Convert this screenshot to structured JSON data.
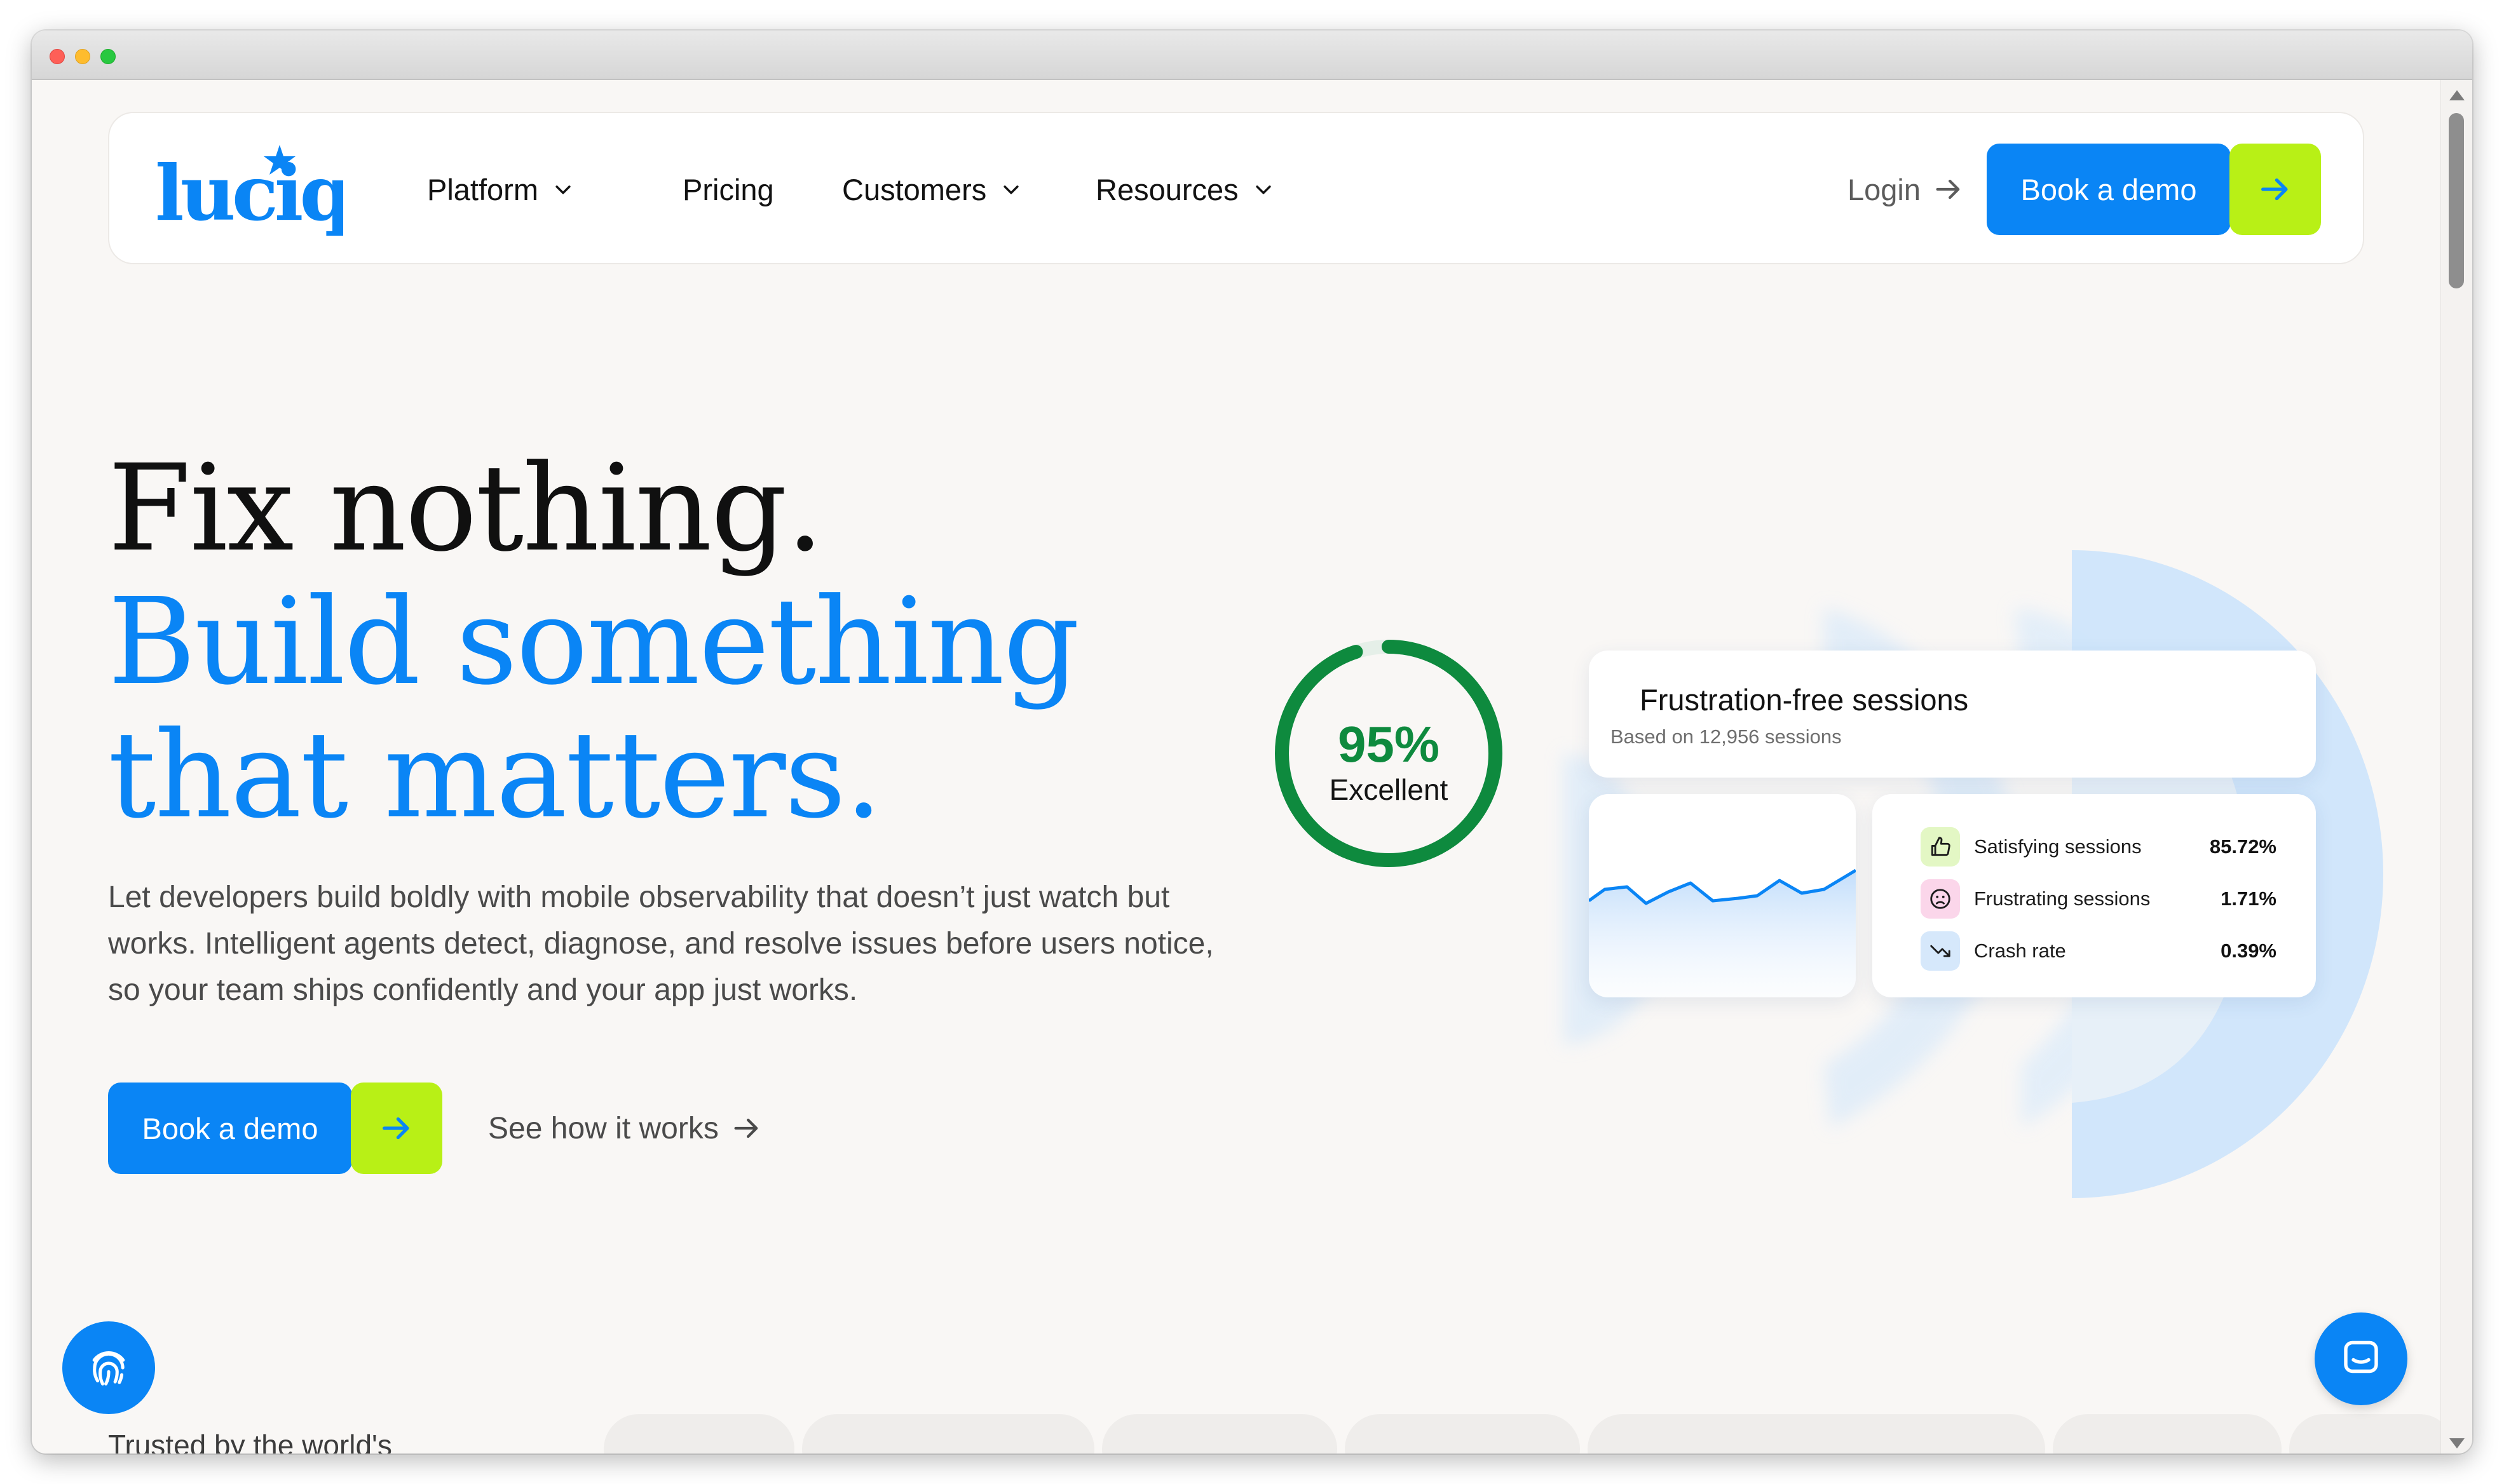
{
  "brand": {
    "name": "luciq",
    "primary": "#0a85f5",
    "accent": "#b8f016",
    "success": "#0e8a3e"
  },
  "nav": {
    "items": [
      {
        "label": "Platform",
        "dropdown": true
      },
      {
        "label": "Pricing",
        "dropdown": false
      },
      {
        "label": "Customers",
        "dropdown": true
      },
      {
        "label": "Resources",
        "dropdown": true
      }
    ],
    "login": "Login",
    "cta": "Book a demo"
  },
  "hero": {
    "line1": "Fix nothing.",
    "line2": "Build something",
    "line3": "that matters.",
    "description": "Let developers build boldly with mobile observability that doesn’t just watch but works. Intelligent agents detect, diagnose, and resolve issues before users notice, so your team ships confidently and your app just works.",
    "cta_primary": "Book a demo",
    "cta_secondary": "See how it works"
  },
  "dashboard": {
    "gauge": {
      "value": "95%",
      "label": "Excellent",
      "fraction": 0.95
    },
    "card_title": "Frustration-free sessions",
    "card_subtitle": "Based on 12,956 sessions",
    "stats": [
      {
        "icon": "thumbs-up-icon",
        "label": "Satisfying sessions",
        "value": "85.72%",
        "bg": "#e3f7c4"
      },
      {
        "icon": "frown-face-icon",
        "label": "Frustrating sessions",
        "value": "1.71%",
        "bg": "#fbd6ea"
      },
      {
        "icon": "trend-down-icon",
        "label": "Crash rate",
        "value": "0.39%",
        "bg": "#d6e8fb"
      }
    ]
  },
  "trusted": "Trusted by the world's"
}
